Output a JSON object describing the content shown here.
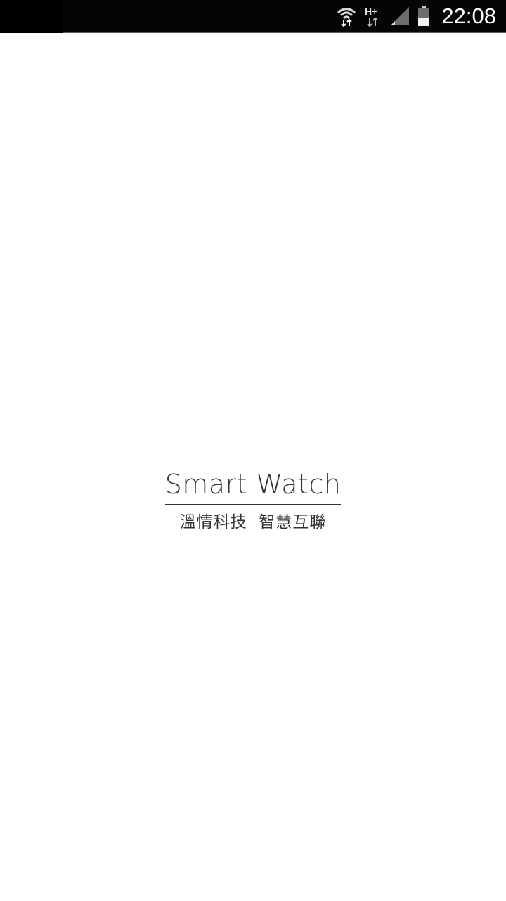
{
  "status_bar": {
    "time": "22:08",
    "network_type": "H+",
    "icons": [
      "wifi-icon",
      "network-type-icon",
      "signal-icon",
      "battery-icon"
    ]
  },
  "splash": {
    "title": "Smart Watch",
    "subtitle": "溫情科技  智慧互聯"
  },
  "colors": {
    "status_bar_bg": "#050508",
    "page_bg": "#ffffff",
    "text": "#333333"
  }
}
